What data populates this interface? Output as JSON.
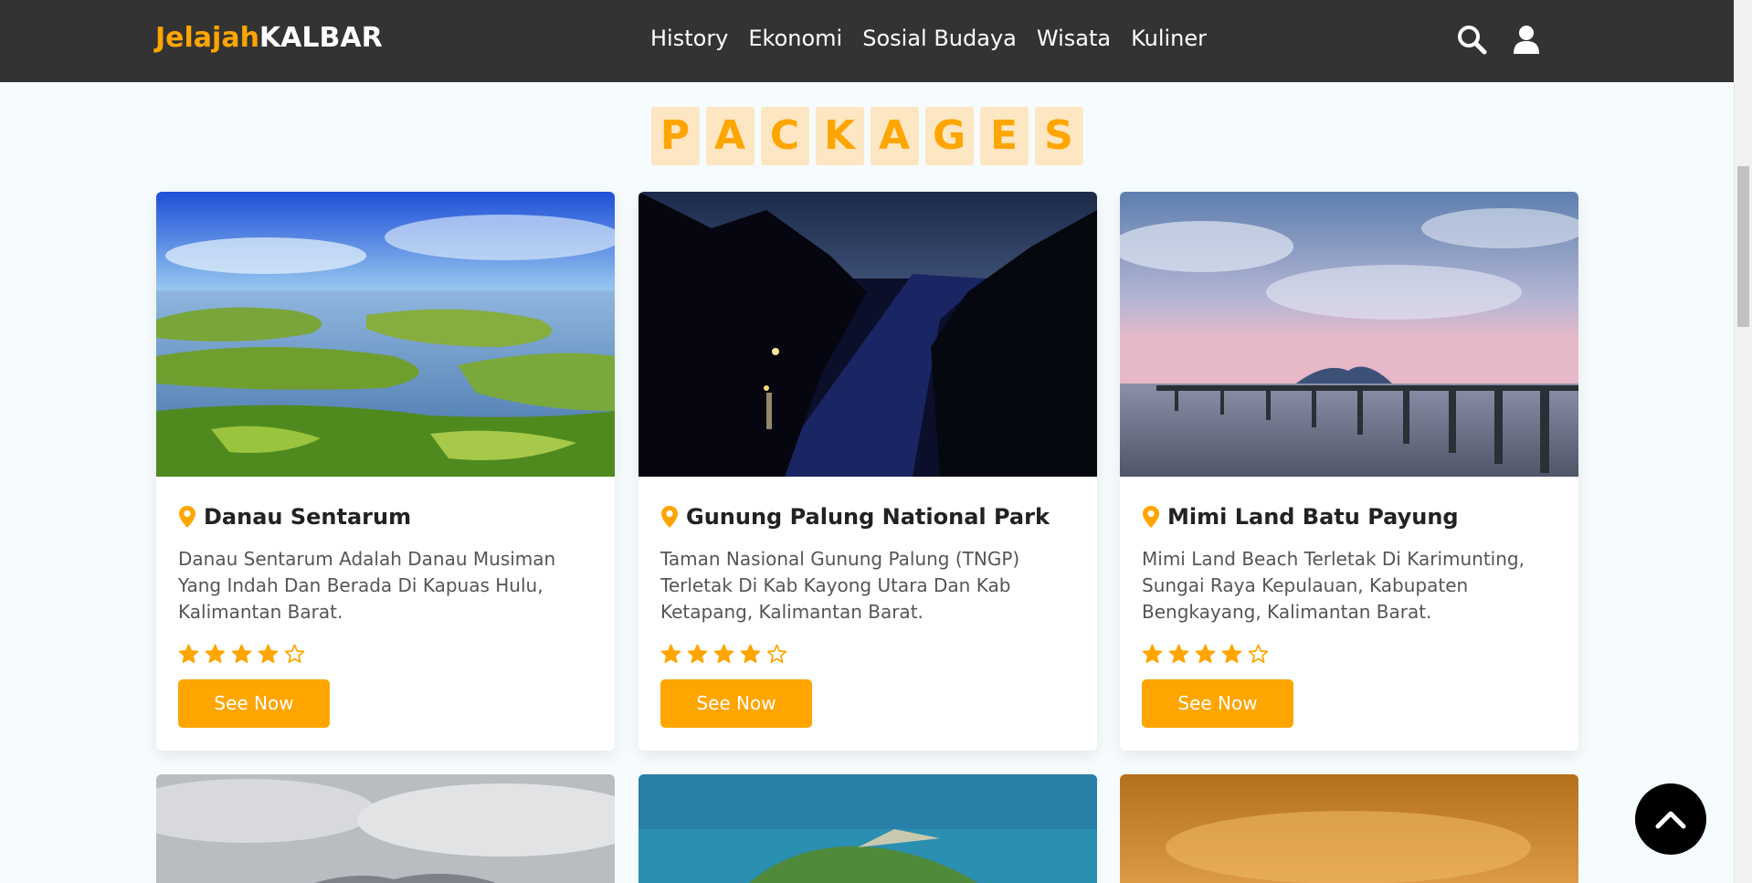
{
  "header": {
    "logo_part1": "Jelajah",
    "logo_part2": "KALBAR",
    "nav": [
      "History",
      "Ekonomi",
      "Sosial Budaya",
      "Wisata",
      "Kuliner"
    ],
    "icons": [
      "search-icon",
      "user-icon"
    ]
  },
  "heading": {
    "letters": [
      "P",
      "A",
      "C",
      "K",
      "A",
      "G",
      "E",
      "S"
    ]
  },
  "packages": [
    {
      "title": "Danau Sentarum",
      "description": "Danau Sentarum Adalah Danau Musiman Yang Indah Dan Berada Di Kapuas Hulu, Kalimantan Barat.",
      "rating": 4,
      "rating_max": 5,
      "button": "See Now"
    },
    {
      "title": "Gunung Palung National Park",
      "description": "Taman Nasional Gunung Palung (TNGP) Terletak Di Kab Kayong Utara Dan Kab Ketapang, Kalimantan Barat.",
      "rating": 4,
      "rating_max": 5,
      "button": "See Now"
    },
    {
      "title": "Mimi Land Batu Payung",
      "description": "Mimi Land Beach Terletak Di Karimunting, Sungai Raya Kepulauan, Kabupaten Bengkayang, Kalimantan Barat.",
      "rating": 4,
      "rating_max": 5,
      "button": "See Now"
    }
  ],
  "colors": {
    "accent": "#ffa500",
    "header_bg": "#333333",
    "page_bg": "#f6fcfd"
  }
}
